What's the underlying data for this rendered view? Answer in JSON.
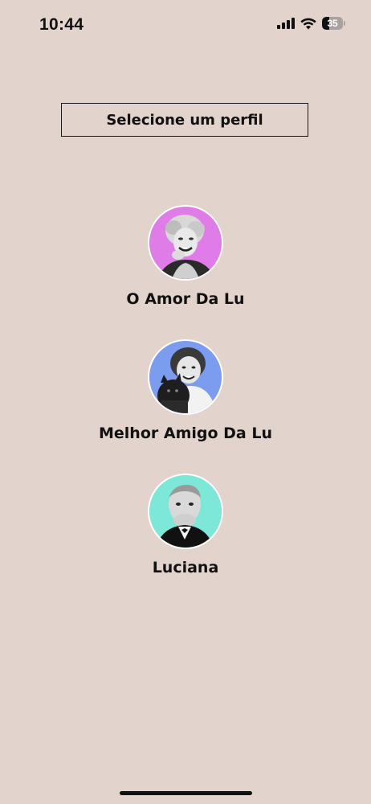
{
  "status_bar": {
    "time": "10:44",
    "battery_percent": "35",
    "battery_level": 0.35,
    "signal_icon": "cellular-signal-icon",
    "wifi_icon": "wifi-icon"
  },
  "header": {
    "title": "Selecione um perfil"
  },
  "profiles": [
    {
      "name": "O Amor Da Lu",
      "avatar_bg": "#e07ce8",
      "avatar_icon": "woman-portrait"
    },
    {
      "name": "Melhor Amigo Da Lu",
      "avatar_bg": "#7c9cf0",
      "avatar_icon": "girl-with-dog-portrait"
    },
    {
      "name": "Luciana",
      "avatar_bg": "#7ee8d8",
      "avatar_icon": "man-in-suit-portrait"
    }
  ],
  "colors": {
    "background": "#e2d3cc",
    "text": "#111111"
  }
}
